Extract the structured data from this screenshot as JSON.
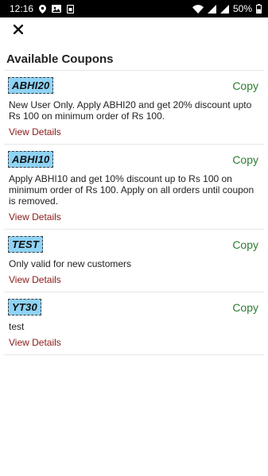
{
  "status_bar": {
    "time": "12:16",
    "battery": "50%",
    "left_icons": [
      "location-icon",
      "gallery-icon",
      "sim-icon"
    ],
    "right_icons": [
      "wifi-icon",
      "signal-icon",
      "signal-icon",
      "battery-icon"
    ]
  },
  "header": {
    "close_icon": "close-icon",
    "title": "Available Coupons"
  },
  "coupons": [
    {
      "code": "ABHI20",
      "copy_label": "Copy",
      "description": "New User Only. Apply ABHI20 and get 20% discount upto Rs 100 on minimum order of Rs 100.",
      "details_label": "View Details"
    },
    {
      "code": "ABHI10",
      "copy_label": "Copy",
      "description": "Apply ABHI10 and get 10% discount up to Rs 100 on minimum order of Rs 100. Apply on all orders until coupon is removed.",
      "details_label": "View Details"
    },
    {
      "code": "TEST",
      "copy_label": "Copy",
      "description": "Only valid for new customers",
      "details_label": "View Details"
    },
    {
      "code": "YT30",
      "copy_label": "Copy",
      "description": "test",
      "details_label": "View Details"
    }
  ],
  "colors": {
    "badge_bg": "#8fd3f5",
    "copy_green": "#2e7d32",
    "details_red": "#8b1a1a"
  }
}
